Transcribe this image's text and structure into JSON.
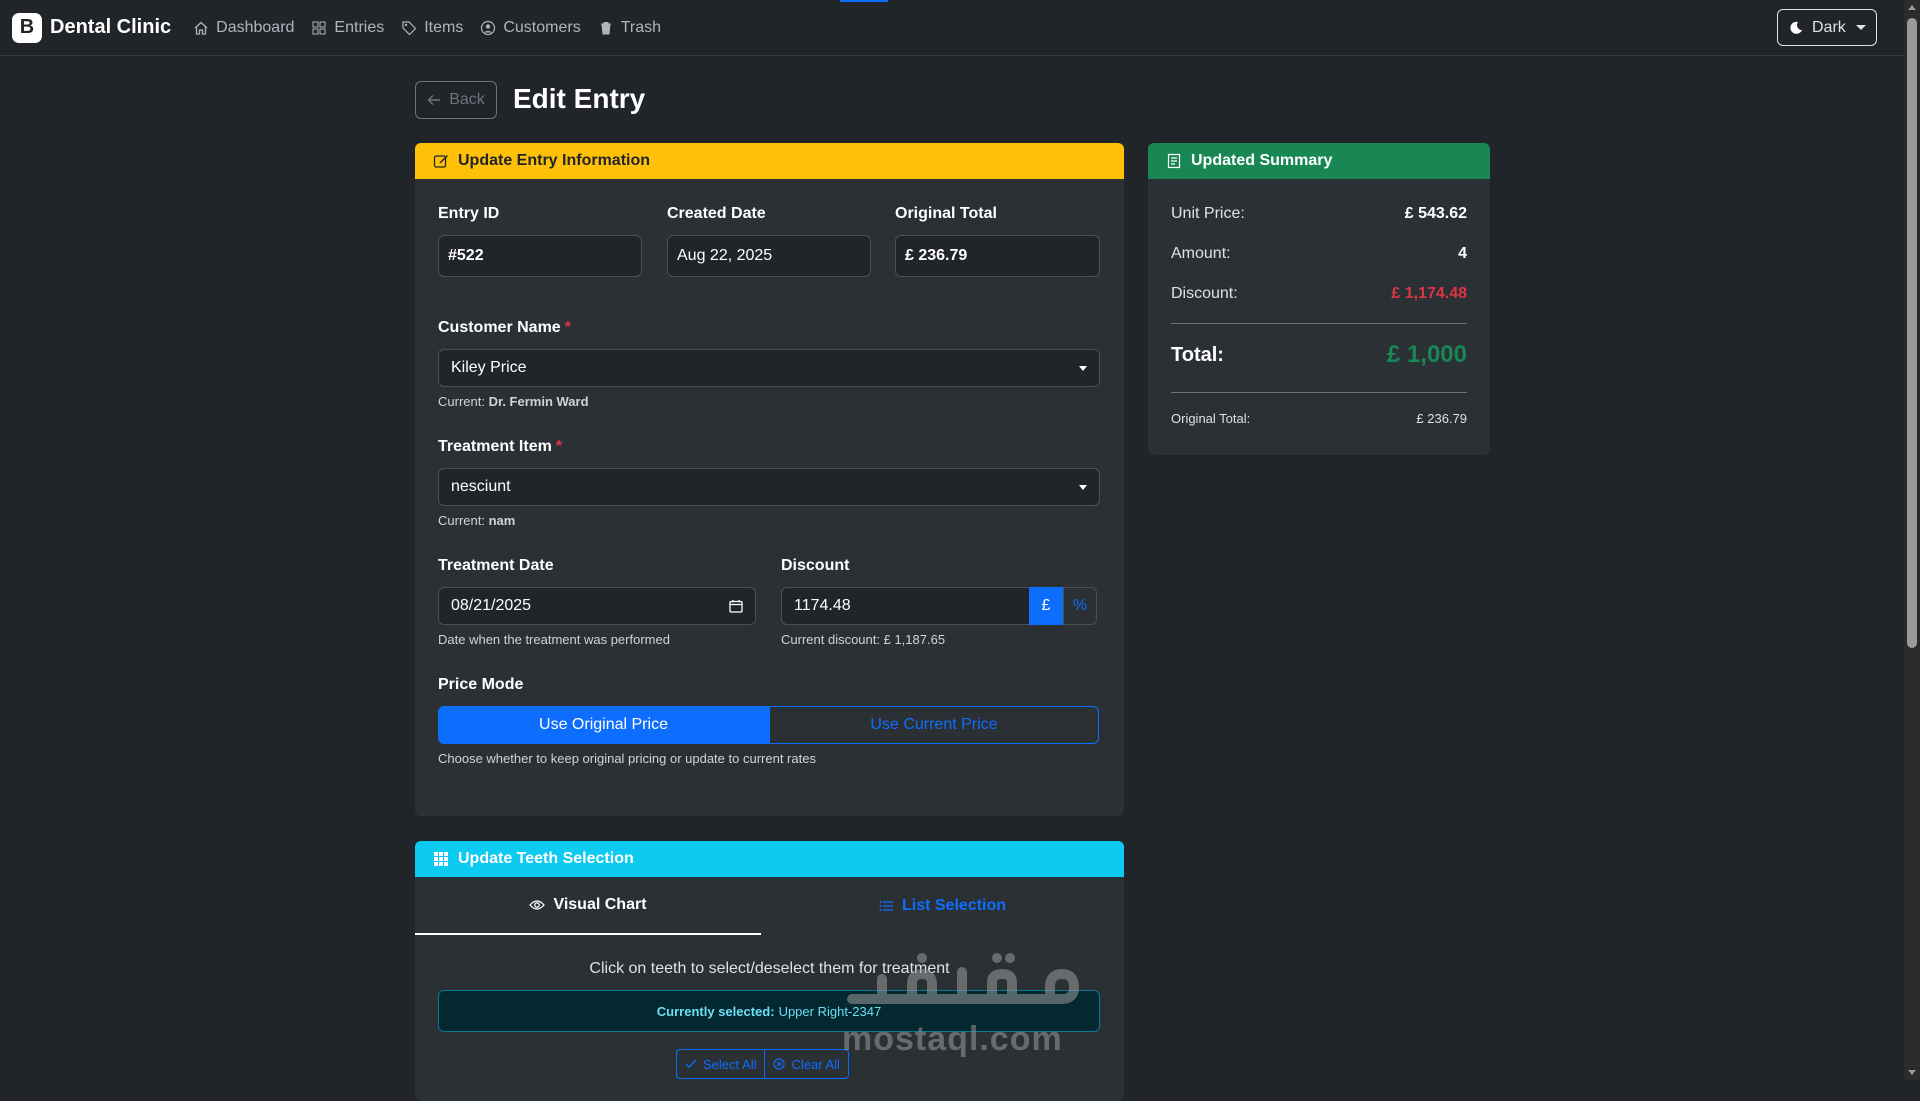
{
  "nav": {
    "brand_logo": "B",
    "brand_name": "Dental Clinic",
    "links": [
      {
        "label": "Dashboard",
        "icon": "house-icon"
      },
      {
        "label": "Entries",
        "icon": "grid-icon"
      },
      {
        "label": "Items",
        "icon": "tag-icon"
      },
      {
        "label": "Customers",
        "icon": "person-circle-icon"
      },
      {
        "label": "Trash",
        "icon": "trash-icon"
      }
    ],
    "theme_label": "Dark"
  },
  "header": {
    "back_label": "Back",
    "title": "Edit Entry"
  },
  "form": {
    "header": "Update Entry Information",
    "entry_id_label": "Entry ID",
    "entry_id": "#522",
    "created_date_label": "Created Date",
    "created_date": "Aug 22, 2025",
    "original_total_label": "Original Total",
    "original_total": "£ 236.79",
    "customer_label": "Customer Name",
    "customer_value": "Kiley Price",
    "customer_current_prefix": "Current:",
    "customer_current": "Dr. Fermin Ward",
    "treatment_label": "Treatment Item",
    "treatment_value": "nesciunt",
    "treatment_current_prefix": "Current:",
    "treatment_current": "nam",
    "treatment_date_label": "Treatment Date",
    "treatment_date": "08/21/2025",
    "treatment_date_help": "Date when the treatment was performed",
    "discount_label": "Discount",
    "discount_value": "1174.48",
    "discount_currency": "£",
    "discount_percent": "%",
    "discount_help": "Current discount: £ 1,187.65",
    "price_mode_label": "Price Mode",
    "price_mode_original": "Use Original Price",
    "price_mode_current": "Use Current Price",
    "price_mode_help": "Choose whether to keep original pricing or update to current rates",
    "required_mark": "*"
  },
  "summary": {
    "header": "Updated Summary",
    "unit_price_label": "Unit Price:",
    "unit_price": "£ 543.62",
    "amount_label": "Amount:",
    "amount": "4",
    "discount_label": "Discount:",
    "discount": "£ 1,174.48",
    "total_label": "Total:",
    "total": "£ 1,000",
    "original_total_label": "Original Total:",
    "original_total": "£ 236.79"
  },
  "teeth": {
    "header": "Update Teeth Selection",
    "tab_visual": "Visual Chart",
    "tab_list": "List Selection",
    "hint": "Click on teeth to select/deselect them for treatment",
    "selected_label": "Currently selected:",
    "selected_value": "Upper Right-2347",
    "select_all": "Select All",
    "clear_all": "Clear All"
  },
  "watermark": {
    "arabic": "مستقل",
    "latin": "mostaql.com"
  },
  "colors": {
    "background": "#212529",
    "card": "#2b3035",
    "primary": "#0d6efd",
    "warning": "#ffc107",
    "success": "#198754",
    "info": "#0dcaf0",
    "danger": "#dc3545"
  }
}
